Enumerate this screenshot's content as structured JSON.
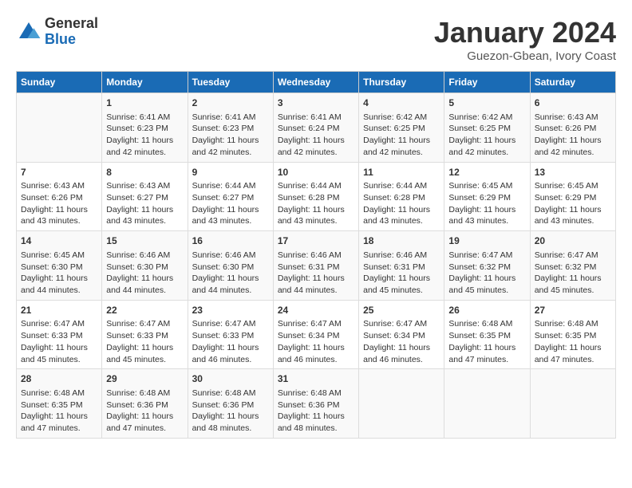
{
  "logo": {
    "general": "General",
    "blue": "Blue"
  },
  "title": "January 2024",
  "location": "Guezon-Gbean, Ivory Coast",
  "days_of_week": [
    "Sunday",
    "Monday",
    "Tuesday",
    "Wednesday",
    "Thursday",
    "Friday",
    "Saturday"
  ],
  "weeks": [
    [
      {
        "day": "",
        "info": ""
      },
      {
        "day": "1",
        "info": "Sunrise: 6:41 AM\nSunset: 6:23 PM\nDaylight: 11 hours\nand 42 minutes."
      },
      {
        "day": "2",
        "info": "Sunrise: 6:41 AM\nSunset: 6:23 PM\nDaylight: 11 hours\nand 42 minutes."
      },
      {
        "day": "3",
        "info": "Sunrise: 6:41 AM\nSunset: 6:24 PM\nDaylight: 11 hours\nand 42 minutes."
      },
      {
        "day": "4",
        "info": "Sunrise: 6:42 AM\nSunset: 6:25 PM\nDaylight: 11 hours\nand 42 minutes."
      },
      {
        "day": "5",
        "info": "Sunrise: 6:42 AM\nSunset: 6:25 PM\nDaylight: 11 hours\nand 42 minutes."
      },
      {
        "day": "6",
        "info": "Sunrise: 6:43 AM\nSunset: 6:26 PM\nDaylight: 11 hours\nand 42 minutes."
      }
    ],
    [
      {
        "day": "7",
        "info": "Sunrise: 6:43 AM\nSunset: 6:26 PM\nDaylight: 11 hours\nand 43 minutes."
      },
      {
        "day": "8",
        "info": "Sunrise: 6:43 AM\nSunset: 6:27 PM\nDaylight: 11 hours\nand 43 minutes."
      },
      {
        "day": "9",
        "info": "Sunrise: 6:44 AM\nSunset: 6:27 PM\nDaylight: 11 hours\nand 43 minutes."
      },
      {
        "day": "10",
        "info": "Sunrise: 6:44 AM\nSunset: 6:28 PM\nDaylight: 11 hours\nand 43 minutes."
      },
      {
        "day": "11",
        "info": "Sunrise: 6:44 AM\nSunset: 6:28 PM\nDaylight: 11 hours\nand 43 minutes."
      },
      {
        "day": "12",
        "info": "Sunrise: 6:45 AM\nSunset: 6:29 PM\nDaylight: 11 hours\nand 43 minutes."
      },
      {
        "day": "13",
        "info": "Sunrise: 6:45 AM\nSunset: 6:29 PM\nDaylight: 11 hours\nand 43 minutes."
      }
    ],
    [
      {
        "day": "14",
        "info": "Sunrise: 6:45 AM\nSunset: 6:30 PM\nDaylight: 11 hours\nand 44 minutes."
      },
      {
        "day": "15",
        "info": "Sunrise: 6:46 AM\nSunset: 6:30 PM\nDaylight: 11 hours\nand 44 minutes."
      },
      {
        "day": "16",
        "info": "Sunrise: 6:46 AM\nSunset: 6:30 PM\nDaylight: 11 hours\nand 44 minutes."
      },
      {
        "day": "17",
        "info": "Sunrise: 6:46 AM\nSunset: 6:31 PM\nDaylight: 11 hours\nand 44 minutes."
      },
      {
        "day": "18",
        "info": "Sunrise: 6:46 AM\nSunset: 6:31 PM\nDaylight: 11 hours\nand 45 minutes."
      },
      {
        "day": "19",
        "info": "Sunrise: 6:47 AM\nSunset: 6:32 PM\nDaylight: 11 hours\nand 45 minutes."
      },
      {
        "day": "20",
        "info": "Sunrise: 6:47 AM\nSunset: 6:32 PM\nDaylight: 11 hours\nand 45 minutes."
      }
    ],
    [
      {
        "day": "21",
        "info": "Sunrise: 6:47 AM\nSunset: 6:33 PM\nDaylight: 11 hours\nand 45 minutes."
      },
      {
        "day": "22",
        "info": "Sunrise: 6:47 AM\nSunset: 6:33 PM\nDaylight: 11 hours\nand 45 minutes."
      },
      {
        "day": "23",
        "info": "Sunrise: 6:47 AM\nSunset: 6:33 PM\nDaylight: 11 hours\nand 46 minutes."
      },
      {
        "day": "24",
        "info": "Sunrise: 6:47 AM\nSunset: 6:34 PM\nDaylight: 11 hours\nand 46 minutes."
      },
      {
        "day": "25",
        "info": "Sunrise: 6:47 AM\nSunset: 6:34 PM\nDaylight: 11 hours\nand 46 minutes."
      },
      {
        "day": "26",
        "info": "Sunrise: 6:48 AM\nSunset: 6:35 PM\nDaylight: 11 hours\nand 47 minutes."
      },
      {
        "day": "27",
        "info": "Sunrise: 6:48 AM\nSunset: 6:35 PM\nDaylight: 11 hours\nand 47 minutes."
      }
    ],
    [
      {
        "day": "28",
        "info": "Sunrise: 6:48 AM\nSunset: 6:35 PM\nDaylight: 11 hours\nand 47 minutes."
      },
      {
        "day": "29",
        "info": "Sunrise: 6:48 AM\nSunset: 6:36 PM\nDaylight: 11 hours\nand 47 minutes."
      },
      {
        "day": "30",
        "info": "Sunrise: 6:48 AM\nSunset: 6:36 PM\nDaylight: 11 hours\nand 48 minutes."
      },
      {
        "day": "31",
        "info": "Sunrise: 6:48 AM\nSunset: 6:36 PM\nDaylight: 11 hours\nand 48 minutes."
      },
      {
        "day": "",
        "info": ""
      },
      {
        "day": "",
        "info": ""
      },
      {
        "day": "",
        "info": ""
      }
    ]
  ]
}
